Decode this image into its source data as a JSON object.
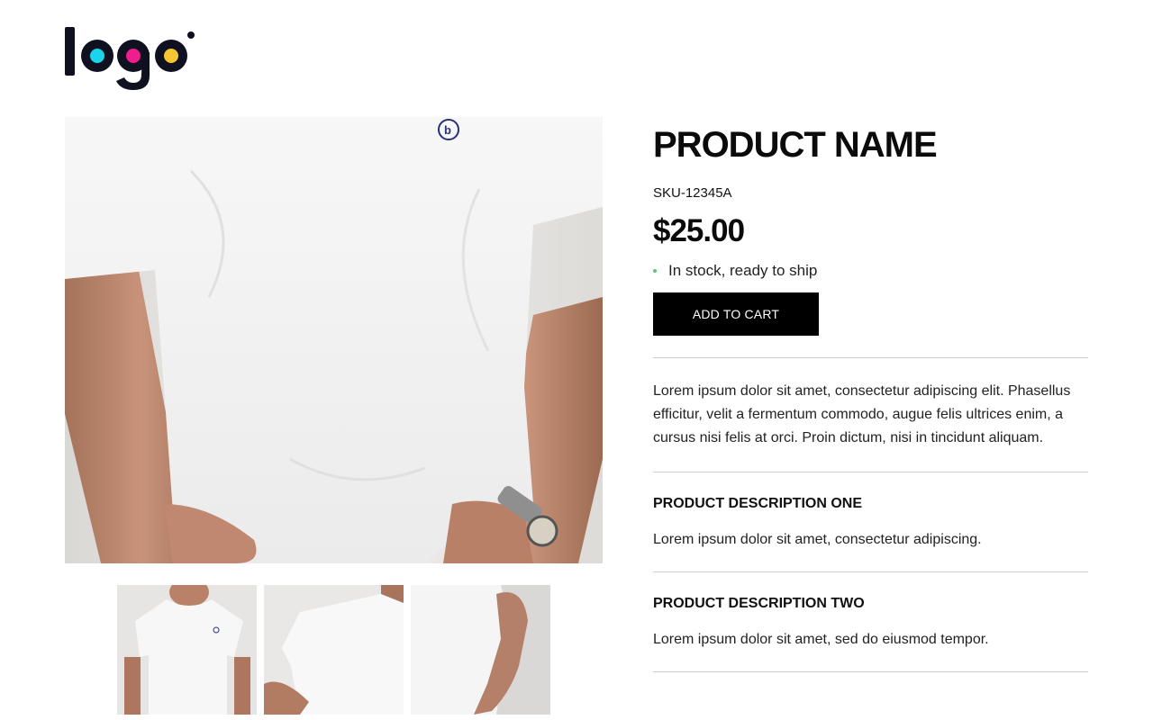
{
  "brand": {
    "logo_text": "logo",
    "dot_colors": [
      "#1ad4ec",
      "#f01d8e",
      "#f7c531"
    ]
  },
  "gallery": {
    "main_image": "white-tshirt-front-closeup",
    "thumbnails": [
      {
        "name": "white-tshirt-front"
      },
      {
        "name": "white-tshirt-back"
      },
      {
        "name": "white-tshirt-side"
      }
    ]
  },
  "product": {
    "title": "PRODUCT NAME",
    "sku": "SKU-12345A",
    "price": "$25.00",
    "stock_status": "In stock, ready to ship",
    "stock_color": "#5ec472",
    "add_to_cart_label": "ADD TO CART",
    "summary": "Lorem ipsum dolor sit amet, consectetur adipiscing elit. Phasellus efficitur, velit a fermentum commodo, augue felis ultrices enim, a cursus nisi felis at orci. Proin dictum, nisi in tincidunt aliquam.",
    "descriptions": [
      {
        "heading": "PRODUCT DESCRIPTION ONE",
        "text": "Lorem ipsum dolor sit amet, consectetur adipiscing."
      },
      {
        "heading": "PRODUCT DESCRIPTION TWO",
        "text": "Lorem ipsum dolor sit amet, sed do eiusmod tempor."
      }
    ]
  }
}
